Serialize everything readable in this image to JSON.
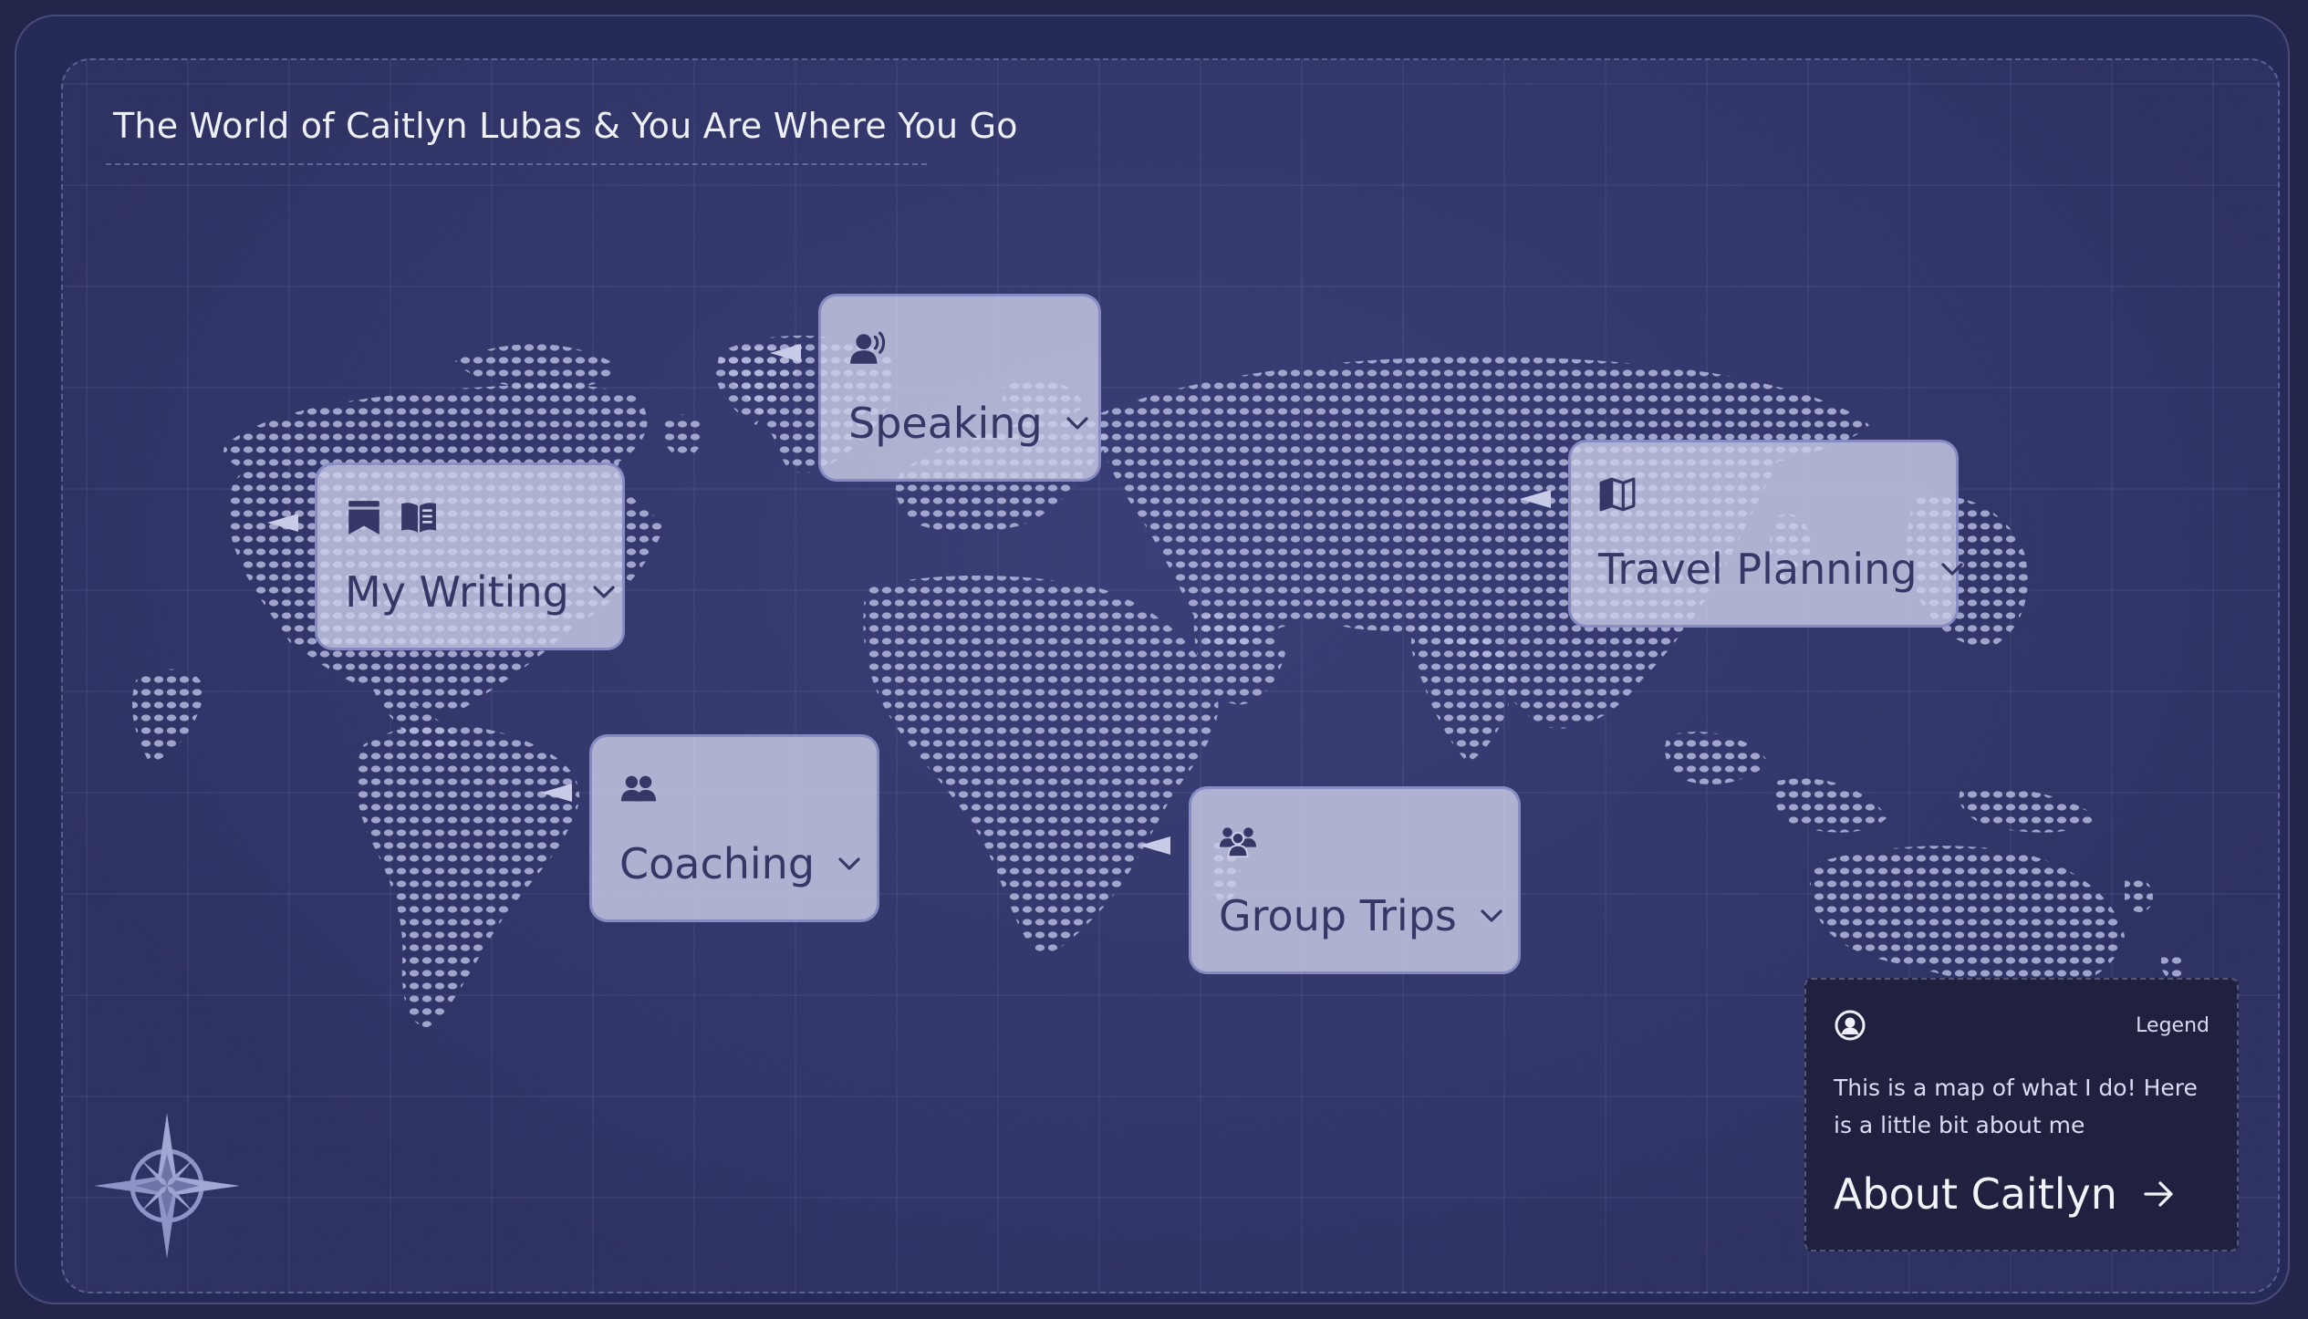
{
  "page": {
    "title": "The World of Caitlyn Lubas & You Are Where You Go"
  },
  "colors": {
    "background": "#262a56",
    "map_panel": "#303466",
    "map_dots": "#b4b7dc",
    "card_fill": "#cdd0e8",
    "card_text": "#353867",
    "legend_fill": "#1f213f",
    "legend_text": "#d9dcf2"
  },
  "cards": [
    {
      "id": "speaking",
      "label": "Speaking",
      "icons": [
        "speaking-person-icon"
      ]
    },
    {
      "id": "writing",
      "label": "My Writing",
      "icons": [
        "bookmark-icon",
        "open-book-icon"
      ]
    },
    {
      "id": "travel",
      "label": "Travel Planning",
      "icons": [
        "folded-map-icon"
      ]
    },
    {
      "id": "coaching",
      "label": "Coaching",
      "icons": [
        "two-people-icon"
      ]
    },
    {
      "id": "group",
      "label": "Group Trips",
      "icons": [
        "group-people-icon"
      ]
    }
  ],
  "legend": {
    "icon": "user-circle-icon",
    "title": "Legend",
    "text": "This is a map of what I do! Here is a little bit about me",
    "link_label": "About Caitlyn",
    "link_icon": "arrow-right-icon"
  },
  "compass_icon": "compass-rose-icon"
}
